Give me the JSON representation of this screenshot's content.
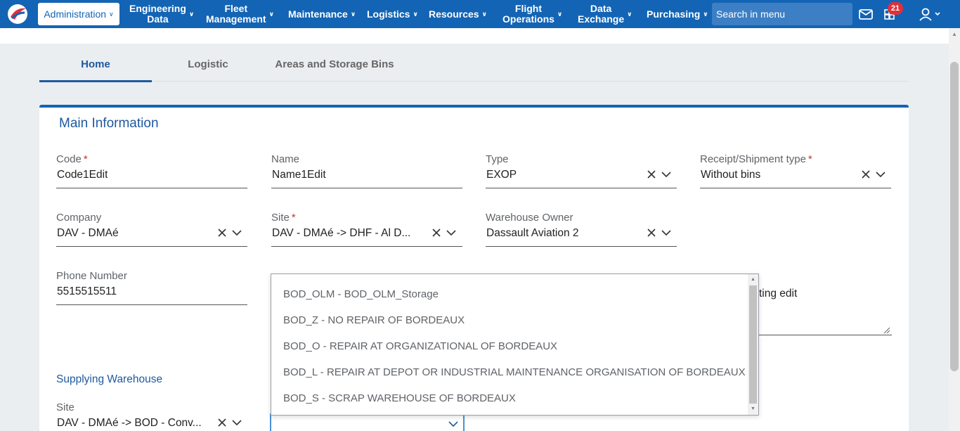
{
  "nav": {
    "active_label": "Administration",
    "items": [
      {
        "label_line1": "Engineering",
        "label_line2": "Data"
      },
      {
        "label_line1": "Fleet",
        "label_line2": "Management"
      },
      {
        "label_line1": "Maintenance",
        "label_line2": ""
      },
      {
        "label_line1": "Logistics",
        "label_line2": ""
      },
      {
        "label_line1": "Resources",
        "label_line2": ""
      },
      {
        "label_line1": "Flight",
        "label_line2": "Operations"
      },
      {
        "label_line1": "Data",
        "label_line2": "Exchange"
      },
      {
        "label_line1": "Purchasing",
        "label_line2": ""
      }
    ],
    "search_placeholder": "Search in menu",
    "badge_count": "21",
    "brand_color": "#1364b4"
  },
  "tabs": [
    {
      "label": "Home",
      "active": true
    },
    {
      "label": "Logistic",
      "active": false
    },
    {
      "label": "Areas and Storage Bins",
      "active": false
    }
  ],
  "main": {
    "title": "Main Information",
    "code": {
      "label": "Code",
      "required": "*",
      "value": "Code1Edit"
    },
    "name": {
      "label": "Name",
      "value": "Name1Edit"
    },
    "type": {
      "label": "Type",
      "value": "EXOP"
    },
    "receipt": {
      "label": "Receipt/Shipment type",
      "required": "*",
      "value": "Without bins"
    },
    "company": {
      "label": "Company",
      "value": "DAV - DMAé"
    },
    "site": {
      "label": "Site",
      "required": "*",
      "value": "DAV - DMAé -> DHF - Al D..."
    },
    "owner": {
      "label": "Warehouse Owner",
      "value": "Dassault Aviation 2"
    },
    "phone": {
      "label": "Phone Number",
      "value": "5515515511"
    },
    "textarea_partial": "ting edit"
  },
  "supplying": {
    "title": "Supplying Warehouse",
    "site": {
      "label": "Site",
      "value": "DAV - DMAé -> BOD - Conv..."
    }
  },
  "dropdown": {
    "options": [
      "BOD_OLM - BOD_OLM_Storage",
      "BOD_Z - NO REPAIR OF BORDEAUX",
      "BOD_O - REPAIR AT ORGANIZATIONAL OF BORDEAUX",
      "BOD_L - REPAIR AT DEPOT OR INDUSTRIAL MAINTENANCE ORGANISATION OF BORDEAUX",
      "BOD_S - SCRAP WAREHOUSE OF BORDEAUX"
    ]
  }
}
